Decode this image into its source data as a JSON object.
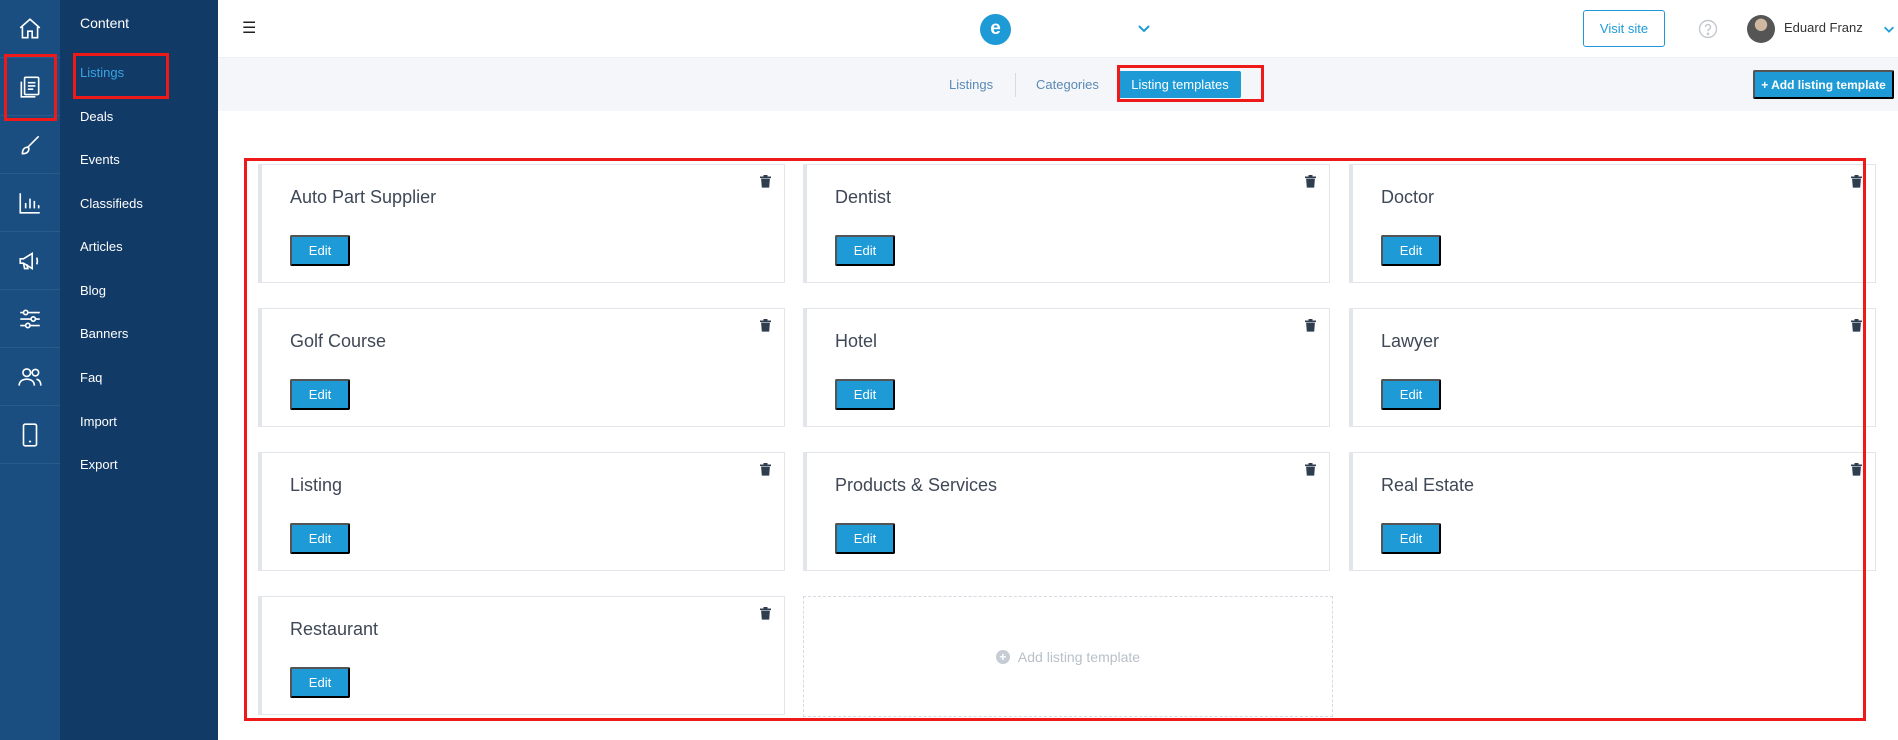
{
  "subnav": {
    "title": "Content",
    "items": [
      "Listings",
      "Deals",
      "Events",
      "Classifieds",
      "Articles",
      "Blog",
      "Banners",
      "Faq",
      "Import",
      "Export"
    ]
  },
  "topbar": {
    "logo_letter": "e",
    "visit_site_label": "Visit site",
    "user_name": "Eduard Franz"
  },
  "tabs": {
    "listings": "Listings",
    "categories": "Categories",
    "listing_templates": "Listing templates"
  },
  "add_listing_template_button": "+ Add listing template",
  "templates": [
    {
      "name": "Auto Part Supplier",
      "edit_label": "Edit"
    },
    {
      "name": "Dentist",
      "edit_label": "Edit"
    },
    {
      "name": "Doctor",
      "edit_label": "Edit"
    },
    {
      "name": "Golf Course",
      "edit_label": "Edit"
    },
    {
      "name": "Hotel",
      "edit_label": "Edit"
    },
    {
      "name": "Lawyer",
      "edit_label": "Edit"
    },
    {
      "name": "Listing",
      "edit_label": "Edit"
    },
    {
      "name": "Products & Services",
      "edit_label": "Edit"
    },
    {
      "name": "Real Estate",
      "edit_label": "Edit"
    },
    {
      "name": "Restaurant",
      "edit_label": "Edit"
    }
  ],
  "add_template_card_label": "Add listing template",
  "colors": {
    "rail": "#1a4e80",
    "subnav": "#123a66",
    "accent": "#1e9ad6",
    "highlight": "#ee1a1a"
  }
}
